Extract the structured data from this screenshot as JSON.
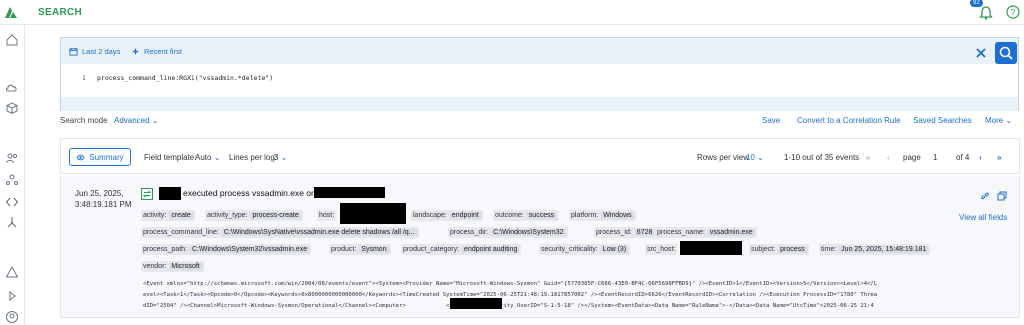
{
  "app": {
    "title": "SEARCH",
    "notification_count": "92"
  },
  "rail_icons": [
    "logo-icon",
    "home-icon",
    "cloud-icon",
    "cube-icon",
    "users-icon",
    "assets-icon",
    "code-icon",
    "network-icon",
    "alert-icon",
    "play-icon",
    "user-icon"
  ],
  "query": {
    "time_range": "Last 2 days",
    "sort_order": "Recent first",
    "line_number": "1",
    "text": "process_command_line:RGXi(\"vssadmin.*delete\")"
  },
  "mode_row": {
    "label": "Search mode",
    "value": "Advanced",
    "save": "Save",
    "convert": "Convert to a Correlation Rule",
    "saved_searches": "Saved Searches",
    "more": "More"
  },
  "toolbar": {
    "summary": "Summary",
    "field_template_label": "Field template:",
    "field_template_value": "Auto",
    "lines_per_log_label": "Lines per log:",
    "lines_per_log_value": "3",
    "rows_per_view_label": "Rows per view",
    "rows_per_view_value": "10",
    "range_text": "1-10 out of 35 events",
    "page_label": "page",
    "page_number": "1",
    "page_total": "of 4"
  },
  "event": {
    "date": "Jun 25, 2025,",
    "time": "3:48:19.181 PM",
    "title_middle": "executed process vssadmin.exe on",
    "view_all": "View all fields",
    "fields_row1": [
      {
        "k": "activity:",
        "v": "create"
      },
      {
        "k": "activity_type:",
        "v": "process-create"
      },
      {
        "k": "host:",
        "v": ""
      },
      {
        "k": "landscape:",
        "v": "endpoint"
      },
      {
        "k": "outcome:",
        "v": "success"
      },
      {
        "k": "platform:",
        "v": "Windows"
      }
    ],
    "fields_row2": [
      {
        "k": "process_command_line:",
        "v": "C:\\Windows\\SysNative\\vssadmin.exe delete shadows /all /q..."
      },
      {
        "k": "process_dir:",
        "v": "C:\\Windows\\System32"
      },
      {
        "k": "process_id:",
        "v": "6728"
      },
      {
        "k": "process_name:",
        "v": "vssadmin.exe"
      }
    ],
    "fields_row3": [
      {
        "k": "process_path:",
        "v": "C:\\Windows\\System32\\vssadmin.exe"
      },
      {
        "k": "product:",
        "v": "Sysmon"
      },
      {
        "k": "product_category:",
        "v": "endpoint auditing"
      },
      {
        "k": "security_criticality:",
        "v": "Low (3)"
      },
      {
        "k": "src_host:",
        "v": ""
      },
      {
        "k": "subject:",
        "v": "process"
      },
      {
        "k": "time:",
        "v": "Jun 25, 2025, 15:48:19.181"
      }
    ],
    "fields_row4": [
      {
        "k": "vendor:",
        "v": "Microsoft"
      }
    ],
    "raw_line1": "<Event xmlns=\"http://schemas.microsoft.com/win/2004/08/events/event\"><System><Provider Name=\"Microsoft-Windows-Sysmon\" Guid=\"{5770385F-C666-43E0-BF4C-06F5698FFBD9}\" /><EventID>1</EventID><Version>5</Version><Level>4</L",
    "raw_line2": "evel><Task>1</Task><Opcode>0</Opcode><Keywords>0x8000000000000000</Keywords><TimeCreated SystemTime=\"2025-06-25T21:48:19.1817857002\" /><EventRecordID>6626</EventRecordID><Correlation /><Execution ProcessID=\"1780\" Threa",
    "raw_line3": "dID=\"2504\" /><Channel>Microsoft-Windows-Sysmon/Operational</Channel><Computer>            </Computer><Security UserID=\"S-1-5-18\" /></System><EventData><Data Name=\"RuleName\">-</Data><Data Name=\"UtcTime\">2025-06-25 21:4"
  },
  "colors": {
    "accent": "#1d6fd1",
    "brand": "#2f9a55"
  }
}
